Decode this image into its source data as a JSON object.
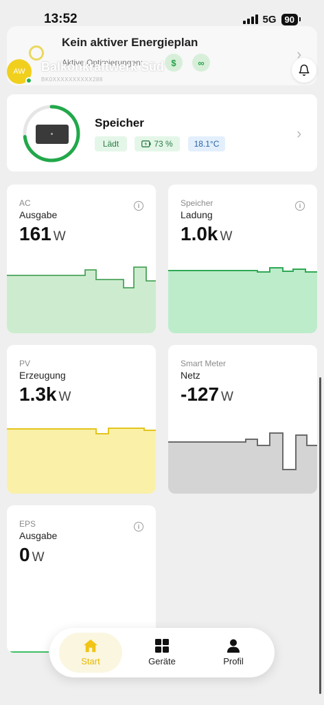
{
  "status_bar": {
    "time": "13:52",
    "network": "5G",
    "battery": "90"
  },
  "plan": {
    "title": "Kein aktiver Energieplan",
    "subtitle": "Aktive Optimierungen:"
  },
  "header": {
    "avatar_initials": "AW",
    "site_name": "Balkonkraftwerk Süd",
    "site_id": "BK0XXXXXXXXXX288"
  },
  "storage": {
    "title": "Speicher",
    "state": "Lädt",
    "soc": "73 %",
    "soc_value": 73,
    "temperature": "18.1°C"
  },
  "tiles": {
    "ac": {
      "category": "AC",
      "name": "Ausgabe",
      "value": "161",
      "unit": "W"
    },
    "speicher": {
      "category": "Speicher",
      "name": "Ladung",
      "value": "1.0k",
      "unit": "W"
    },
    "pv": {
      "category": "PV",
      "name": "Erzeugung",
      "value": "1.3k",
      "unit": "W"
    },
    "netz": {
      "category": "Smart Meter",
      "name": "Netz",
      "value": "-127",
      "unit": "W"
    },
    "eps": {
      "category": "EPS",
      "name": "Ausgabe",
      "value": "0",
      "unit": "W"
    }
  },
  "nav": {
    "home": "Start",
    "devices": "Geräte",
    "profile": "Profil"
  },
  "colors": {
    "accent": "#e6b800",
    "green": "#22a84a",
    "ac_fill": "#cdeccf",
    "storage_fill": "#bdeccb",
    "pv_fill": "#faf0a8",
    "grid_fill": "#d4d4d4"
  }
}
